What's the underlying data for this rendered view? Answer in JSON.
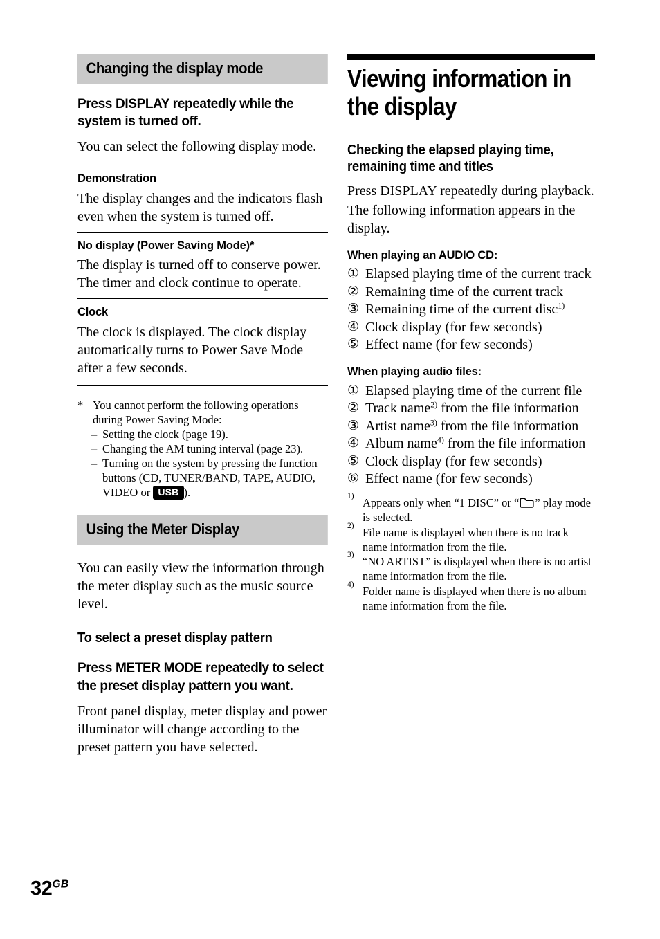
{
  "page": {
    "number": "32",
    "region_suffix": "GB"
  },
  "left_column": {
    "section_header": "Changing the display mode",
    "instruction": "Press DISPLAY repeatedly while the system is turned off.",
    "intro": "You can select the following display mode.",
    "modes": [
      {
        "name": "Demonstration",
        "description": "The display changes and the indicators flash even when the system is turned off."
      },
      {
        "name": "No display (Power Saving Mode)*",
        "description": "The display is turned off to conserve power. The timer and clock continue to operate."
      },
      {
        "name": "Clock",
        "description": "The clock is displayed. The clock display automatically turns to Power Save Mode after a few seconds."
      }
    ],
    "footnote": {
      "marker": "*",
      "lead": "You cannot perform the following operations during Power Saving Mode:",
      "items": [
        "Setting the clock (page 19).",
        "Changing the AM tuning interval (page 23)."
      ],
      "last_item_before_badge": "Turning on the system by pressing the function buttons (CD, TUNER/BAND, TAPE, AUDIO, VIDEO or",
      "badge_label": "USB",
      "last_item_after_badge": ")."
    },
    "meter_section": {
      "header": "Using the Meter Display",
      "body": "You can easily view the information through the meter display such as the music source level.",
      "subheading": "To select a preset display pattern",
      "instruction": "Press METER MODE repeatedly to select the preset display pattern you want.",
      "description": "Front panel display, meter display and power illuminator will change according to the preset pattern you have selected."
    }
  },
  "right_column": {
    "title": "Viewing information in the display",
    "subheading": "Checking the elapsed playing time, remaining time and titles",
    "intro_line1": "Press DISPLAY repeatedly during playback.",
    "intro_line2": "The following information appears in the display.",
    "audio_cd": {
      "heading": "When playing an AUDIO CD:",
      "items": [
        {
          "num": "①",
          "text": "Elapsed playing time of the current track",
          "sup": ""
        },
        {
          "num": "②",
          "text": "Remaining time of the current track",
          "sup": ""
        },
        {
          "num": "③",
          "text": "Remaining time of the current disc",
          "sup": "1)"
        },
        {
          "num": "④",
          "text": "Clock display (for few seconds)",
          "sup": ""
        },
        {
          "num": "⑤",
          "text": "Effect name (for few seconds)",
          "sup": ""
        }
      ]
    },
    "audio_files": {
      "heading": "When playing audio files:",
      "items": [
        {
          "num": "①",
          "text_before": "Elapsed playing time of the current file",
          "sup": "",
          "text_after": ""
        },
        {
          "num": "②",
          "text_before": "Track name",
          "sup": "2)",
          "text_after": " from the file information"
        },
        {
          "num": "③",
          "text_before": "Artist name",
          "sup": "3)",
          "text_after": " from the file information"
        },
        {
          "num": "④",
          "text_before": "Album name",
          "sup": "4)",
          "text_after": " from the file information"
        },
        {
          "num": "⑤",
          "text_before": "Clock display (for few seconds)",
          "sup": "",
          "text_after": ""
        },
        {
          "num": "⑥",
          "text_before": "Effect name (for few seconds)",
          "sup": "",
          "text_after": ""
        }
      ]
    },
    "footnotes": [
      {
        "marker": "1)",
        "text_before": "Appears only when “1 DISC” or “",
        "icon": "folder-icon",
        "text_after": "” play mode is selected."
      },
      {
        "marker": "2)",
        "text_before": "File name is displayed when there is no track name information from the file.",
        "icon": "",
        "text_after": ""
      },
      {
        "marker": "3)",
        "text_before": "“NO ARTIST” is displayed when there is no artist name information from the file.",
        "icon": "",
        "text_after": ""
      },
      {
        "marker": "4)",
        "text_before": "Folder name is displayed when there is no album name information from the file.",
        "icon": "",
        "text_after": ""
      }
    ]
  },
  "colors": {
    "band_gray": "#c9c9c9",
    "rule_black": "#000000",
    "text": "#000000",
    "page_background": "#ffffff"
  }
}
